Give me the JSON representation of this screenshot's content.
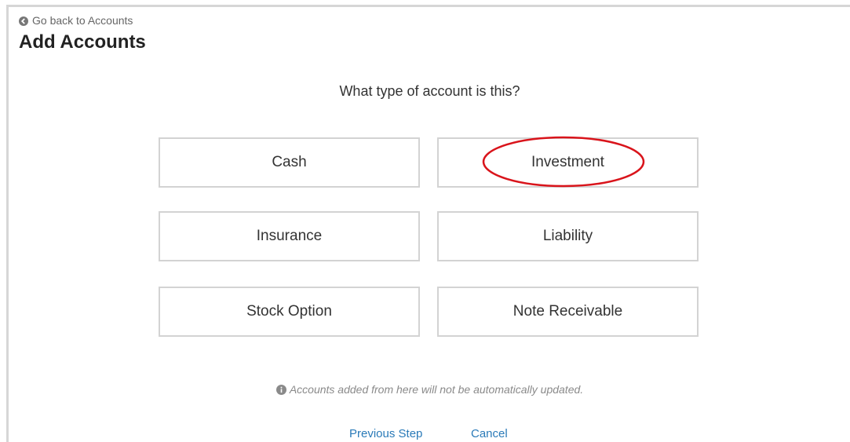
{
  "header": {
    "back_label": "Go back to Accounts",
    "title": "Add Accounts"
  },
  "main": {
    "question": "What type of account is this?",
    "account_types": [
      {
        "label": "Cash",
        "highlighted": false
      },
      {
        "label": "Investment",
        "highlighted": true
      },
      {
        "label": "Insurance",
        "highlighted": false
      },
      {
        "label": "Liability",
        "highlighted": false
      },
      {
        "label": "Stock Option",
        "highlighted": false
      },
      {
        "label": "Note Receivable",
        "highlighted": false
      }
    ],
    "notice": "Accounts added from here will not be automatically updated."
  },
  "footer": {
    "previous_label": "Previous Step",
    "cancel_label": "Cancel"
  },
  "colors": {
    "link": "#2a7ab8",
    "highlight": "#d9141b",
    "border": "#d3d3d3"
  }
}
